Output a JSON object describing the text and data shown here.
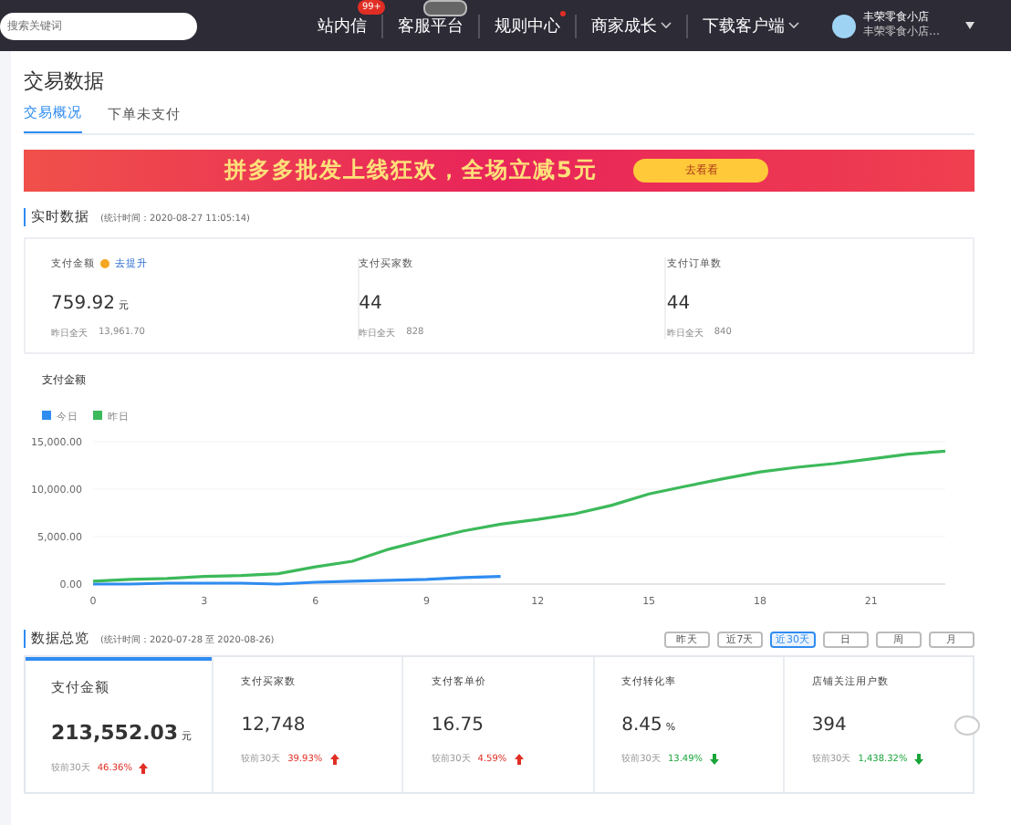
{
  "top_bar": {
    "search": {
      "placeholder": "搜索关键词"
    },
    "nav": [
      {
        "label": "站内信",
        "badge": "99+",
        "tag": false,
        "dot": false,
        "caret": false
      },
      {
        "label": "客服平台",
        "tag": true,
        "dot": false,
        "caret": false
      },
      {
        "label": "规则中心",
        "tag": false,
        "dot": true,
        "caret": false
      },
      {
        "label": "商家成长",
        "tag": false,
        "dot": false,
        "caret": true
      },
      {
        "label": "下载客户端",
        "tag": false,
        "dot": false,
        "caret": true
      }
    ],
    "store": {
      "name": "丰荣零食小店",
      "subtitle": "丰荣零食小店…"
    }
  },
  "page_title": "交易数据",
  "tabs": [
    {
      "label": "交易概况",
      "selected": true
    },
    {
      "label": "下单未支付",
      "selected": false
    }
  ],
  "banner": {
    "text": "拼多多批发上线狂欢，全场立减5元",
    "button": "去看看"
  },
  "realtime": {
    "title": "实时数据",
    "time": "(统计时间：2020-08-27 11:05:14)",
    "metrics": [
      {
        "label": "支付金额",
        "hint": "去提升",
        "value": "759.92",
        "unit": "元",
        "compare_label": "昨日全天",
        "compare": "13,961.70"
      },
      {
        "label": "支付买家数",
        "value": "44",
        "compare_label": "昨日全天",
        "compare": "828"
      },
      {
        "label": "支付订单数",
        "value": "44",
        "compare_label": "昨日全天",
        "compare": "840"
      }
    ],
    "chart_data": {
      "type": "line",
      "title": "支付金额",
      "x": [
        0,
        1,
        2,
        3,
        4,
        5,
        6,
        7,
        8,
        9,
        10,
        11,
        12,
        13,
        14,
        15,
        16,
        17,
        18,
        19,
        20,
        21,
        22,
        23
      ],
      "xlim": [
        0,
        23
      ],
      "ylim": [
        0,
        15000
      ],
      "xticks": [
        0,
        3,
        6,
        9,
        12,
        15,
        18,
        21
      ],
      "yticks": [
        {
          "value": 0,
          "label": "0.00"
        },
        {
          "value": 5000,
          "label": "5,000.00"
        },
        {
          "value": 10000,
          "label": "10,000.00"
        },
        {
          "value": 15000,
          "label": "15,000.00"
        }
      ],
      "legend": "top",
      "series": [
        {
          "name": "今日",
          "color": "#2f8cf0",
          "values": [
            0,
            0,
            100,
            100,
            100,
            0,
            200,
            300,
            400,
            500,
            700,
            800,
            null,
            null,
            null,
            null,
            null,
            null,
            null,
            null,
            null,
            null,
            null,
            null
          ]
        },
        {
          "name": "昨日",
          "color": "#3cb95a",
          "values": [
            300,
            500,
            600,
            800,
            900,
            1100,
            1800,
            2400,
            3700,
            4700,
            5600,
            6300,
            6800,
            7400,
            8300,
            9500,
            10300,
            11100,
            11800,
            12300,
            12700,
            13200,
            13700,
            14000
          ]
        }
      ]
    }
  },
  "overview": {
    "title": "数据总览",
    "time": "(统计时间：2020-07-28 至 2020-08-26)",
    "ranges": [
      {
        "label": "昨天",
        "selected": false
      },
      {
        "label": "近7天",
        "selected": false
      },
      {
        "label": "近30天",
        "selected": true
      },
      {
        "label": "日",
        "selected": false
      },
      {
        "label": "周",
        "selected": false
      },
      {
        "label": "月",
        "selected": false
      }
    ],
    "cards": [
      {
        "label": "支付金额",
        "value": "213,552.03",
        "unit": "元",
        "compare_label": "较前30天",
        "change": "46.36%",
        "rising": true,
        "selected": true
      },
      {
        "label": "支付买家数",
        "value": "12,748",
        "compare_label": "较前30天",
        "change": "39.93%",
        "rising": true,
        "selected": false
      },
      {
        "label": "支付客单价",
        "value": "16.75",
        "compare_label": "较前30天",
        "change": "4.59%",
        "rising": true,
        "selected": false
      },
      {
        "label": "支付转化率",
        "value": "8.45",
        "unit": "%",
        "compare_label": "较前30天",
        "change": "13.49%",
        "rising": false,
        "selected": false
      },
      {
        "label": "店铺关注用户数",
        "value": "394",
        "compare_label": "较前30天",
        "change": "1,438.32%",
        "rising": false,
        "selected": false
      }
    ]
  }
}
